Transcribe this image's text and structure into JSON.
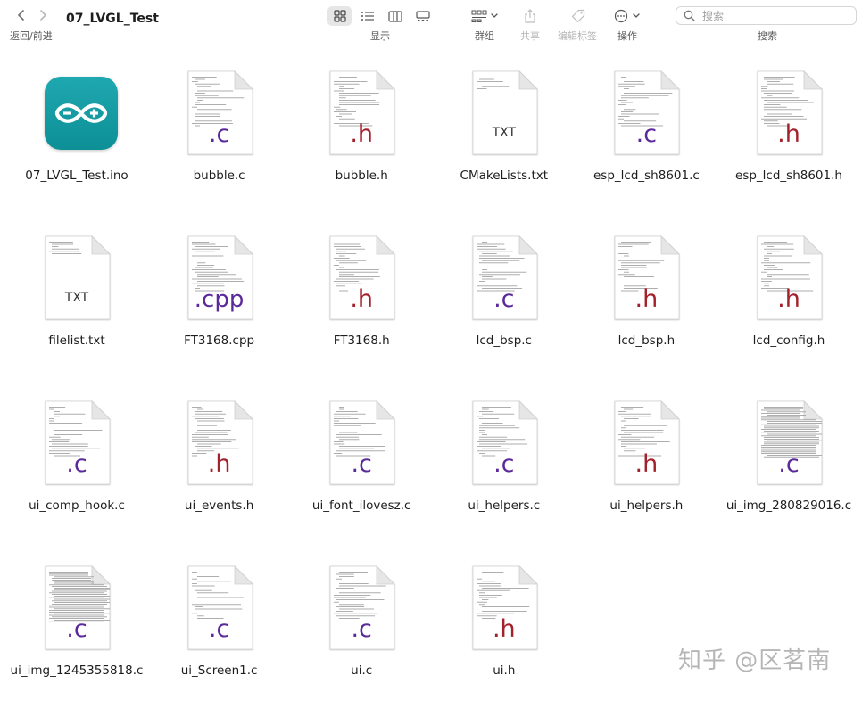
{
  "toolbar": {
    "nav_label": "返回/前进",
    "window_title": "07_LVGL_Test",
    "view_label": "显示",
    "group_label": "群组",
    "share_label": "共享",
    "tags_label": "编辑标签",
    "action_label": "操作",
    "search_label": "搜索",
    "search_placeholder": "搜索"
  },
  "files": [
    {
      "name": "07_LVGL_Test.ino",
      "kind": "arduino"
    },
    {
      "name": "bubble.c",
      "kind": "doc",
      "ext": ".c",
      "ext_color": "#5b2a9a"
    },
    {
      "name": "bubble.h",
      "kind": "doc",
      "ext": ".h",
      "ext_color": "#a3212a"
    },
    {
      "name": "CMakeLists.txt",
      "kind": "doc",
      "ext": "TXT",
      "ext_color": "#333333"
    },
    {
      "name": "esp_lcd_sh8601.c",
      "kind": "doc",
      "ext": ".c",
      "ext_color": "#5b2a9a"
    },
    {
      "name": "esp_lcd_sh8601.h",
      "kind": "doc",
      "ext": ".h",
      "ext_color": "#a3212a"
    },
    {
      "name": "filelist.txt",
      "kind": "doc",
      "ext": "TXT",
      "ext_color": "#333333"
    },
    {
      "name": "FT3168.cpp",
      "kind": "doc",
      "ext": ".cpp",
      "ext_color": "#5b2a9a"
    },
    {
      "name": "FT3168.h",
      "kind": "doc",
      "ext": ".h",
      "ext_color": "#a3212a"
    },
    {
      "name": "lcd_bsp.c",
      "kind": "doc",
      "ext": ".c",
      "ext_color": "#5b2a9a"
    },
    {
      "name": "lcd_bsp.h",
      "kind": "doc",
      "ext": ".h",
      "ext_color": "#a3212a"
    },
    {
      "name": "lcd_config.h",
      "kind": "doc",
      "ext": ".h",
      "ext_color": "#a3212a"
    },
    {
      "name": "ui_comp_hook.c",
      "kind": "doc",
      "ext": ".c",
      "ext_color": "#5b2a9a"
    },
    {
      "name": "ui_events.h",
      "kind": "doc",
      "ext": ".h",
      "ext_color": "#a3212a"
    },
    {
      "name": "ui_font_ilovesz.c",
      "kind": "doc",
      "ext": ".c",
      "ext_color": "#5b2a9a"
    },
    {
      "name": "ui_helpers.c",
      "kind": "doc",
      "ext": ".c",
      "ext_color": "#5b2a9a"
    },
    {
      "name": "ui_helpers.h",
      "kind": "doc",
      "ext": ".h",
      "ext_color": "#a3212a"
    },
    {
      "name": "ui_img_280829016.c",
      "kind": "doc",
      "ext": ".c",
      "ext_color": "#5b2a9a"
    },
    {
      "name": "ui_img_1245355818.c",
      "kind": "doc",
      "ext": ".c",
      "ext_color": "#5b2a9a"
    },
    {
      "name": "ui_Screen1.c",
      "kind": "doc",
      "ext": ".c",
      "ext_color": "#5b2a9a"
    },
    {
      "name": "ui.c",
      "kind": "doc",
      "ext": ".c",
      "ext_color": "#5b2a9a"
    },
    {
      "name": "ui.h",
      "kind": "doc",
      "ext": ".h",
      "ext_color": "#a3212a"
    }
  ],
  "watermark": "知乎 @区茗南"
}
